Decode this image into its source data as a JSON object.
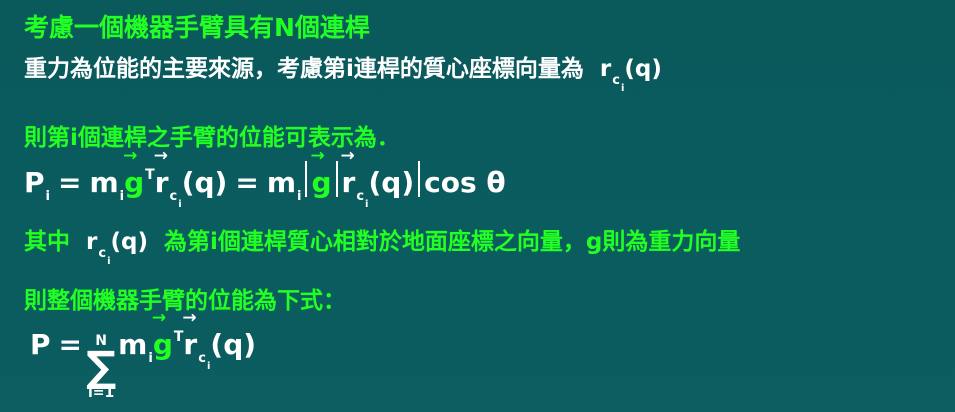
{
  "lines": {
    "l1": "考慮一個機器手臂具有N個連桿",
    "l2_text": "重力為位能的主要來源，考慮第i連桿的質心座標向量為",
    "l2_formula_r": "r",
    "l2_formula_c": "c",
    "l2_formula_i": "i",
    "l2_formula_q": "(q)",
    "l3": "則第i個連桿之手臂的位能可表示為．",
    "l5_prefix": "其中",
    "l5_formula_r": "r",
    "l5_formula_c": "c",
    "l5_formula_i": "i",
    "l5_formula_q": "(q)",
    "l5_suffix": "為第i個連桿質心相對於地面座標之向量，g則為重力向量",
    "l6": "則整個機器手臂的位能為下式："
  },
  "formula1": {
    "p": "P",
    "p_sub": "i",
    "eq1": "=",
    "m1": "m",
    "m1_sub": "i",
    "g1": "g",
    "g1_sup": "T",
    "r1": "r",
    "r1_sub": "c",
    "r1_subsub": "i",
    "q1": "(q)",
    "eq2": "=",
    "m2": "m",
    "m2_sub": "i",
    "g2": "g",
    "r2": "r",
    "r2_sub": "c",
    "r2_subsub": "i",
    "q2": "(q)",
    "cos": "cos θ"
  },
  "formula2": {
    "p": "P",
    "eq": "=",
    "sum_top": "N",
    "sum": "∑",
    "sum_bottom": "i=1",
    "m": "m",
    "m_sub": "i",
    "g": "g",
    "g_sup": "T",
    "r": "r",
    "r_sub": "c",
    "r_subsub": "i",
    "q": "(q)"
  }
}
